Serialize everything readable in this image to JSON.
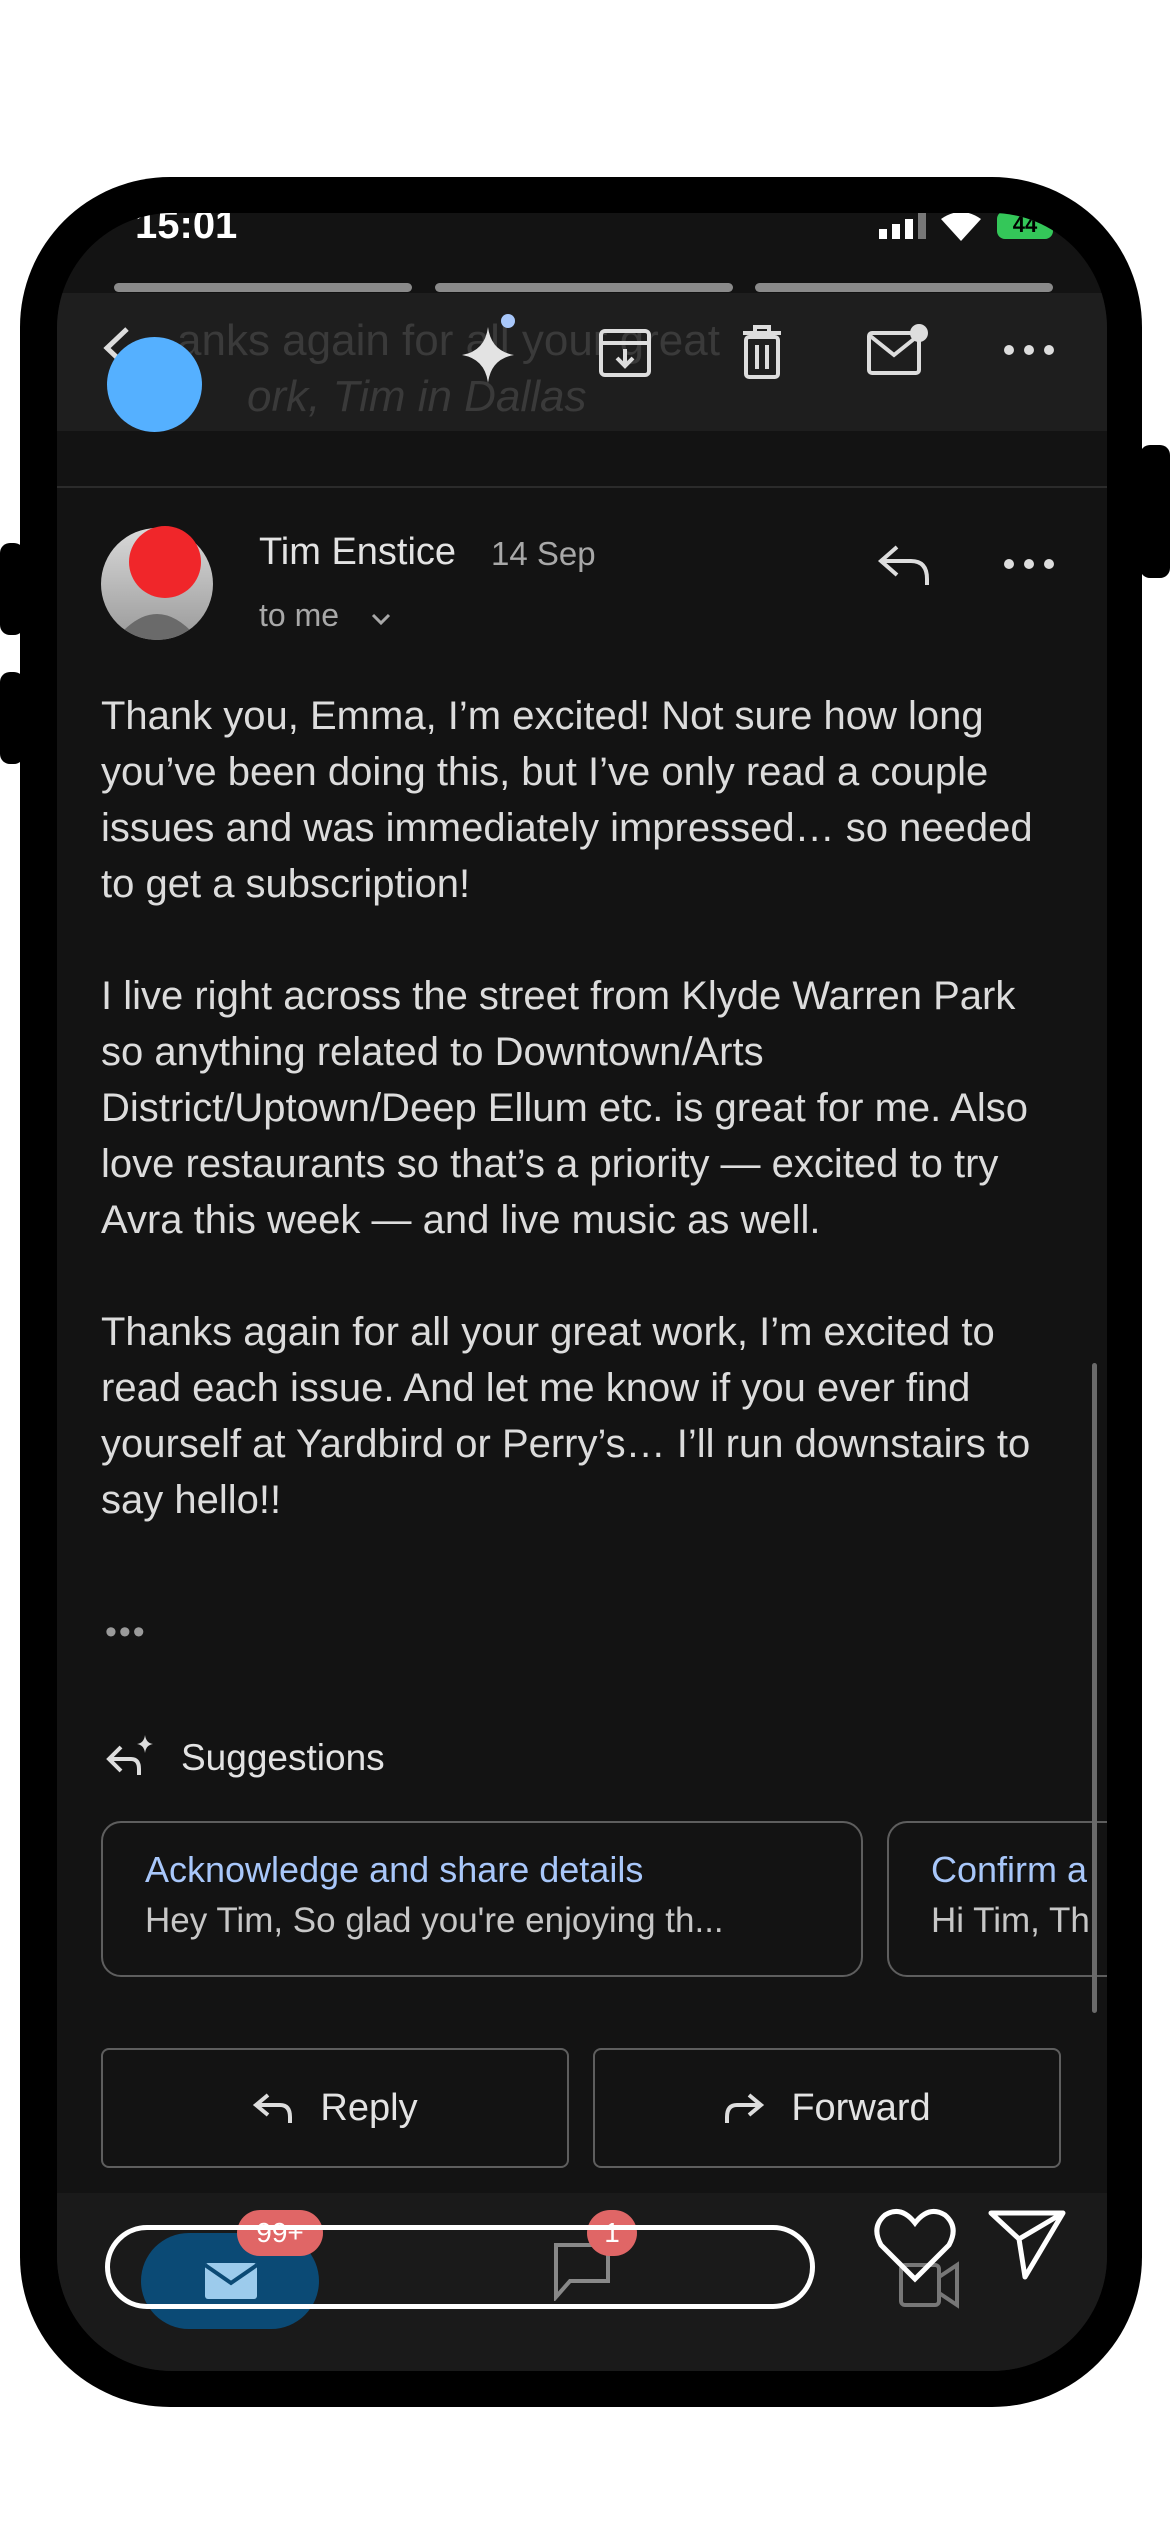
{
  "status_bar": {
    "time": "15:01",
    "battery": "44"
  },
  "toolbar": {
    "ghost_text_line1": "anks again for all your great",
    "ghost_text_line2": "ork, Tim in Dallas",
    "icons": [
      "back-icon",
      "sparkle-icon",
      "archive-icon",
      "delete-icon",
      "mark-unread-icon",
      "more-icon"
    ]
  },
  "message": {
    "sender": "Tim Enstice",
    "date": "14 Sep",
    "recipient": "to me",
    "paragraphs": [
      "Thank you, Emma, I’m excited! Not sure how long you’ve been doing this, but I’ve only read a couple issues and was immediately impressed… so needed to get a subscription!",
      "I live right across the street from Klyde Warren Park so anything related to Downtown/Arts District/Uptown/Deep Ellum etc. is great for me. Also love restaurants so that’s a priority — excited to try Avra this week — and live music as well.",
      "Thanks again for all your great work, I’m excited to read each issue. And let me know if you ever find yourself at Yardbird or Perry’s… I’ll run downstairs to say hello!!"
    ],
    "trimmed": "•••"
  },
  "suggestions": {
    "label": "Suggestions",
    "cards": [
      {
        "title": "Acknowledge and share details",
        "snippet": "Hey Tim, So glad you're enjoying th..."
      },
      {
        "title": "Confirm a",
        "snippet": "Hi Tim, Th"
      }
    ]
  },
  "actions": {
    "reply": "Reply",
    "forward": "Forward"
  },
  "bottom_nav": {
    "mail_badge": "99+",
    "chat_badge": "1"
  },
  "colors": {
    "background": "#131313",
    "accent_link": "#a8c7fa",
    "badge": "#e06666",
    "mail_pill": "#0b4a75"
  }
}
